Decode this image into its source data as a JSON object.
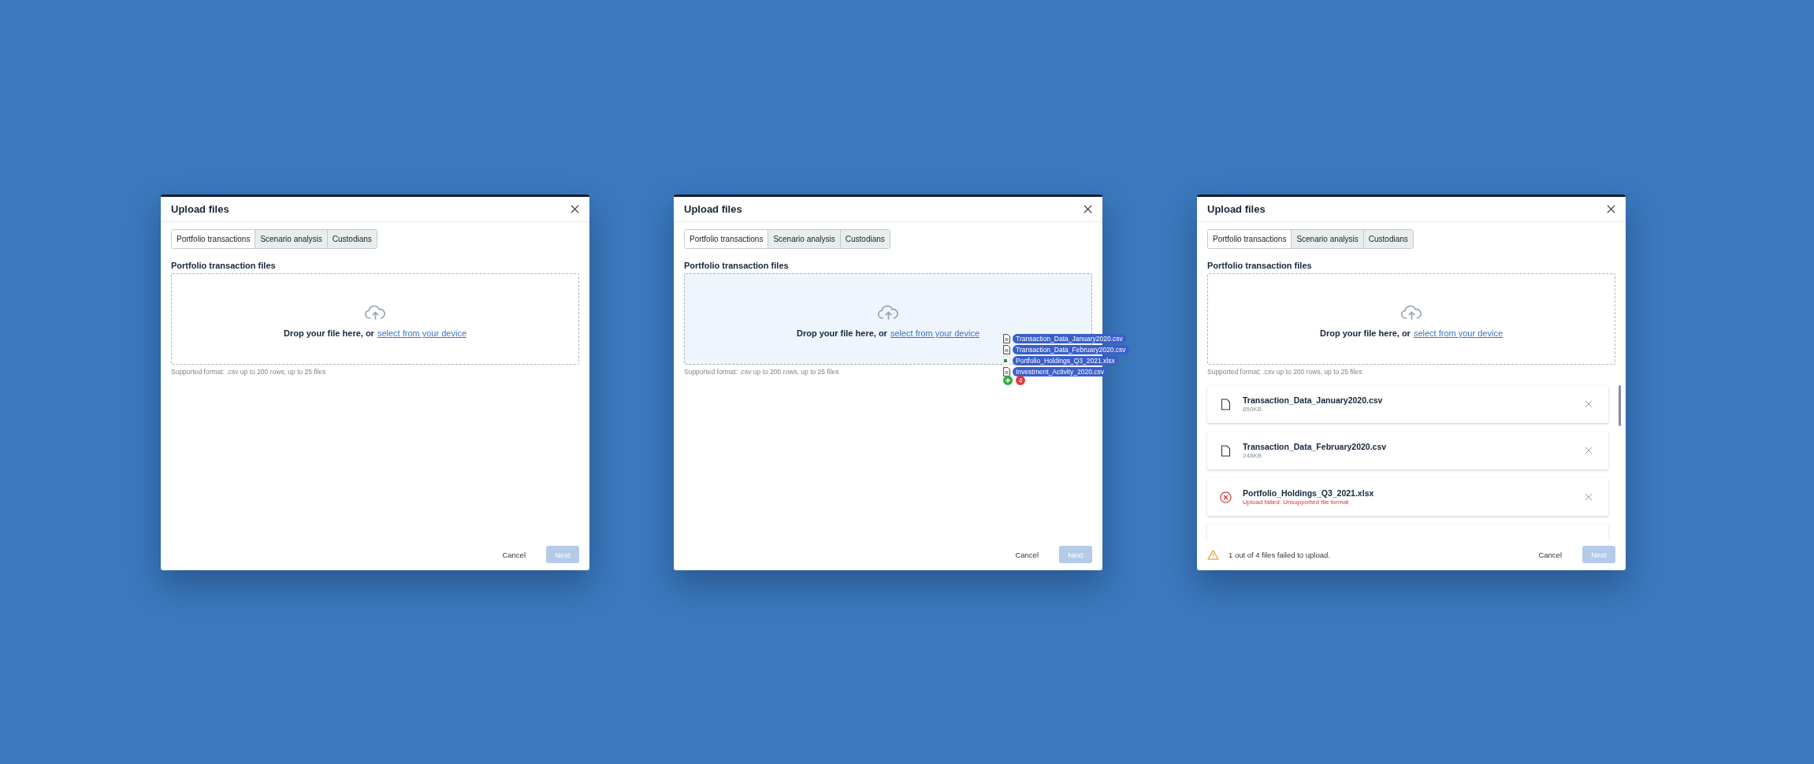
{
  "dialogs": [
    {
      "title": "Upload files",
      "tabs": [
        {
          "label": "Portfolio transactions",
          "selected": true
        },
        {
          "label": "Scenario analysis",
          "selected": false
        },
        {
          "label": "Custodians",
          "selected": false
        }
      ],
      "section_label": "Portfolio transaction files",
      "dropzone": {
        "text": "Drop your file here, or",
        "link": "select from your device",
        "drag_over": false
      },
      "hint": "Supported format: .csv up to 200 rows, up to 25 files",
      "footer": {
        "cancel": "Cancel",
        "next": "Next",
        "next_disabled": true
      }
    },
    {
      "title": "Upload files",
      "tabs": [
        {
          "label": "Portfolio transactions",
          "selected": true
        },
        {
          "label": "Scenario analysis",
          "selected": false
        },
        {
          "label": "Custodians",
          "selected": false
        }
      ],
      "section_label": "Portfolio transaction files",
      "dropzone": {
        "text": "Drop your file here, or",
        "link": "select from your device",
        "drag_over": true
      },
      "hint": "Supported format: .csv up to 200 rows, up to 25 files",
      "drag_preview": {
        "items": [
          {
            "name": "Transaction_Data_January2020.csv",
            "kind": "csv"
          },
          {
            "name": "Transaction_Data_February2020.csv",
            "kind": "csv"
          },
          {
            "name": "Portfolio_Holdings_Q3_2021.xlsx",
            "kind": "xlsx"
          },
          {
            "name": "Investment_Activity_2020.csv",
            "kind": "csv"
          }
        ],
        "count": "4"
      },
      "footer": {
        "cancel": "Cancel",
        "next": "Next",
        "next_disabled": true
      }
    },
    {
      "title": "Upload files",
      "tabs": [
        {
          "label": "Portfolio transactions",
          "selected": true
        },
        {
          "label": "Scenario analysis",
          "selected": false
        },
        {
          "label": "Custodians",
          "selected": false
        }
      ],
      "section_label": "Portfolio transaction files",
      "dropzone": {
        "text": "Drop your file here, or",
        "link": "select from your device",
        "drag_over": false
      },
      "hint": "Supported format: .csv up to 200 rows, up to 25 files",
      "files": [
        {
          "name": "Transaction_Data_January2020.csv",
          "detail": "850KB",
          "kind": "uploaded"
        },
        {
          "name": "Transaction_Data_February2020.csv",
          "detail": "248KB",
          "kind": "uploaded"
        },
        {
          "name": "Portfolio_Holdings_Q3_2021.xlsx",
          "detail": "Upload failed: Unsupported file format",
          "kind": "failed"
        },
        {
          "kind": "partial"
        }
      ],
      "footer": {
        "message": "1 out of 4 files failed to upload.",
        "cancel": "Cancel",
        "next": "Next",
        "next_disabled": true
      }
    }
  ]
}
